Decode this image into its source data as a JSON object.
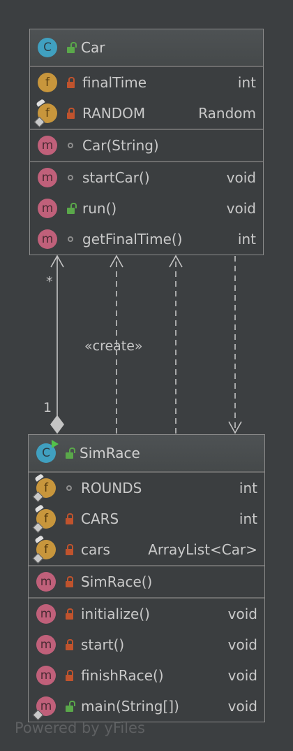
{
  "classes": [
    {
      "name": "Car",
      "sections": [
        [
          {
            "name": "finalTime",
            "type": "int"
          },
          {
            "name": "RANDOM",
            "type": "Random"
          }
        ],
        [
          {
            "name": "Car(String)",
            "type": ""
          }
        ],
        [
          {
            "name": "startCar()",
            "type": "void"
          },
          {
            "name": "run()",
            "type": "void"
          },
          {
            "name": "getFinalTime()",
            "type": "int"
          }
        ]
      ]
    },
    {
      "name": "SimRace",
      "sections": [
        [
          {
            "name": "ROUNDS",
            "type": "int"
          },
          {
            "name": "CARS",
            "type": "int"
          },
          {
            "name": "cars",
            "type": "ArrayList<Car>"
          }
        ],
        [
          {
            "name": "SimRace()",
            "type": ""
          }
        ],
        [
          {
            "name": "initialize()",
            "type": "void"
          },
          {
            "name": "start()",
            "type": "void"
          },
          {
            "name": "finishRace()",
            "type": "void"
          },
          {
            "name": "main(String[])",
            "type": "void"
          }
        ]
      ]
    }
  ],
  "edges": {
    "composition": {
      "source_multiplicity": "1",
      "target_multiplicity": "*"
    },
    "create_label": "«create»"
  },
  "icons": {
    "class_kind": "C",
    "method_kind": "m",
    "field_kind": "f"
  },
  "colors": {
    "background": "#3c3f41",
    "class_icon": "#40a0c0",
    "method_icon": "#c0607a",
    "field_icon": "#c8963c",
    "private_lock": "#c0532d",
    "public_lock": "#5aa84a"
  },
  "watermark": "Powered by yFiles"
}
